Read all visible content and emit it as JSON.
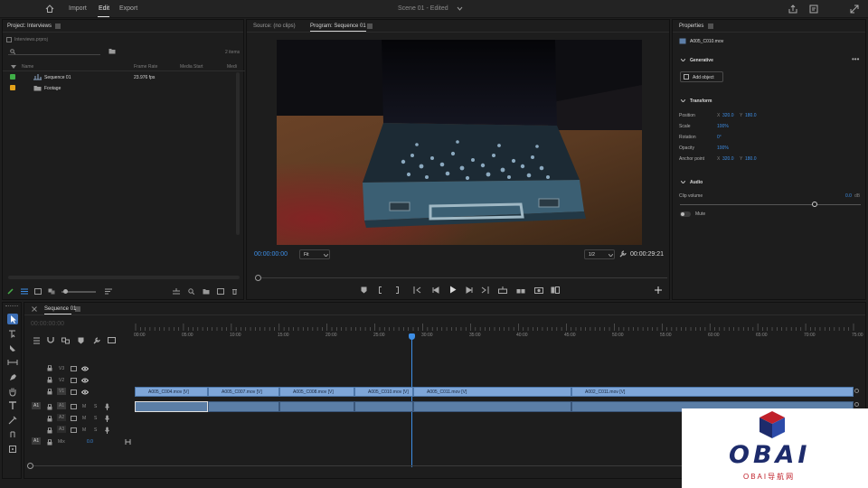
{
  "topbar": {
    "menu": [
      "Import",
      "Edit",
      "Export"
    ],
    "active": "Edit",
    "scene_title": "Scene 01 - Edited"
  },
  "project": {
    "tab": "Project: Interviews",
    "file": "Interviews.prproj",
    "search_placeholder": "",
    "item_count": "2 items",
    "columns": [
      "Name",
      "Frame Rate",
      "Media Start",
      "Medi"
    ],
    "items": [
      {
        "name": "Sequence 01",
        "frame_rate": "23.976 fps",
        "color": "#3fae47"
      },
      {
        "name": "Footage",
        "frame_rate": "",
        "color": "#e3a21a"
      }
    ]
  },
  "viewer": {
    "source_tab": "Source: (no clips)",
    "program_tab": "Program: Sequence 01",
    "timecode": "00:00:00:00",
    "fit": "Fit",
    "quality": "1/2",
    "duration": "00:00:29:21"
  },
  "properties": {
    "tab": "Properties",
    "clip": "A005_C010.mov",
    "generative": {
      "title": "Generative",
      "add_object": "Add object"
    },
    "transform": {
      "title": "Transform",
      "rows": [
        {
          "label": "Position",
          "v1_label": "X",
          "v1": "320.0",
          "v2_label": "Y",
          "v2": "180.0"
        },
        {
          "label": "Scale",
          "v1_label": "",
          "v1": "100%",
          "v2_label": "",
          "v2": ""
        },
        {
          "label": "Rotation",
          "v1_label": "",
          "v1": "0°",
          "v2_label": "",
          "v2": ""
        },
        {
          "label": "Opacity",
          "v1_label": "",
          "v1": "100%",
          "v2_label": "",
          "v2": ""
        },
        {
          "label": "Anchor point",
          "v1_label": "X",
          "v1": "320.0",
          "v2_label": "Y",
          "v2": "180.0"
        }
      ]
    },
    "audio": {
      "title": "Audio",
      "clip_volume_label": "Clip volume",
      "clip_volume": "0.0",
      "unit": "dB",
      "volume_level": 0.75,
      "mute_label": "Mute"
    }
  },
  "timeline": {
    "tab": "Sequence 01",
    "timecode": "00:00:00:00",
    "ruler": [
      "00:00",
      "05:00",
      "10:00",
      "15:00",
      "20:00",
      "25:00",
      "30:00",
      "35:00",
      "40:00",
      "45:00",
      "50:00",
      "55:00",
      "60:00",
      "65:00",
      "70:00",
      "75:00"
    ],
    "tracks": {
      "video": [
        "V3",
        "V2",
        "V1"
      ],
      "audio": [
        "A1",
        "A2",
        "A3"
      ],
      "source_v": "V1",
      "source_a": "A1",
      "mix_label": "Mix",
      "mix_value": "0.0",
      "audio_btns": [
        "M",
        "S"
      ]
    },
    "clips": [
      "A005_C004.mov [V]",
      "A005_C007.mov [V]",
      "A005_C008.mov [V]",
      "A005_C010.mov [V]",
      "A005_C011.mov [V]",
      "A002_C011.mov [V]"
    ]
  },
  "watermark": {
    "logo_text": "OBAI",
    "subtitle": "OBAI导航网"
  }
}
